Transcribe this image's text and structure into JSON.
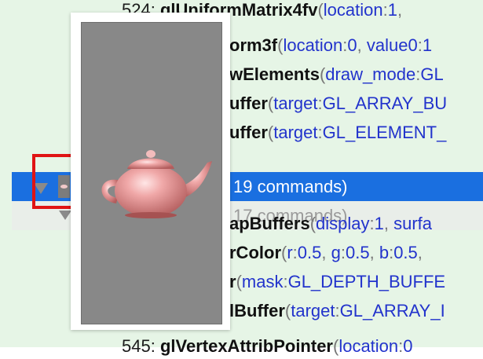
{
  "commands": [
    {
      "id": "cmd-524",
      "index": "524:",
      "name": "glUniformMatrix4fv",
      "params": [
        {
          "k": "location",
          "v": "1"
        }
      ],
      "trailing": ","
    },
    {
      "id": "cmd-uniform3f",
      "index": "",
      "name": "orm3f",
      "params": [
        {
          "k": "location",
          "v": "0"
        },
        {
          "k": "value0",
          "v": "1"
        }
      ],
      "trailing": ""
    },
    {
      "id": "cmd-drawelements",
      "index": "",
      "name": "wElements",
      "params": [
        {
          "k": "draw_mode",
          "v": "GL"
        }
      ],
      "trailing": ""
    },
    {
      "id": "cmd-bindbuffer-array",
      "index": "",
      "name": "uffer",
      "params": [
        {
          "k": "target",
          "v": "GL_ARRAY_BU"
        }
      ],
      "trailing": ""
    },
    {
      "id": "cmd-bindbuffer-element",
      "index": "",
      "name": "uffer",
      "params": [
        {
          "k": "target",
          "v": "GL_ELEMENT_"
        }
      ],
      "trailing": ""
    }
  ],
  "group_selected": {
    "label": "19 commands)"
  },
  "group_collapsed": {
    "label": "17 commands)"
  },
  "commands_after": [
    {
      "id": "cmd-swapbuffers",
      "name": "apBuffers",
      "params": [
        {
          "k": "display",
          "v": "1"
        },
        {
          "k": "surfa",
          "v": ""
        }
      ],
      "trailing": ""
    },
    {
      "id": "cmd-clearcolor",
      "name": "rColor",
      "params": [
        {
          "k": "r",
          "v": "0.5"
        },
        {
          "k": "g",
          "v": "0.5"
        },
        {
          "k": "b",
          "v": "0.5"
        }
      ],
      "trailing": ","
    },
    {
      "id": "cmd-clear",
      "name": "r",
      "params": [
        {
          "k": "mask",
          "v": "GL_DEPTH_BUFFE"
        }
      ],
      "trailing": ""
    },
    {
      "id": "cmd-bindbuffer-2",
      "name": "lBuffer",
      "params": [
        {
          "k": "target",
          "v": "GL_ARRAY_I"
        }
      ],
      "trailing": ""
    },
    {
      "id": "cmd-545",
      "index": "545:",
      "name": "glVertexAttribPointer",
      "params": [
        {
          "k": "location",
          "v": "0"
        }
      ],
      "trailing": ""
    }
  ],
  "thumbnail": {
    "icon": "teapot-render-icon",
    "background": "#888888",
    "teapot_color": "#e89a9a"
  },
  "colors": {
    "selection": "#1a6fe0",
    "panel": "#e6f5e6",
    "param_name": "#2233cc",
    "highlight_box": "#e01414"
  }
}
